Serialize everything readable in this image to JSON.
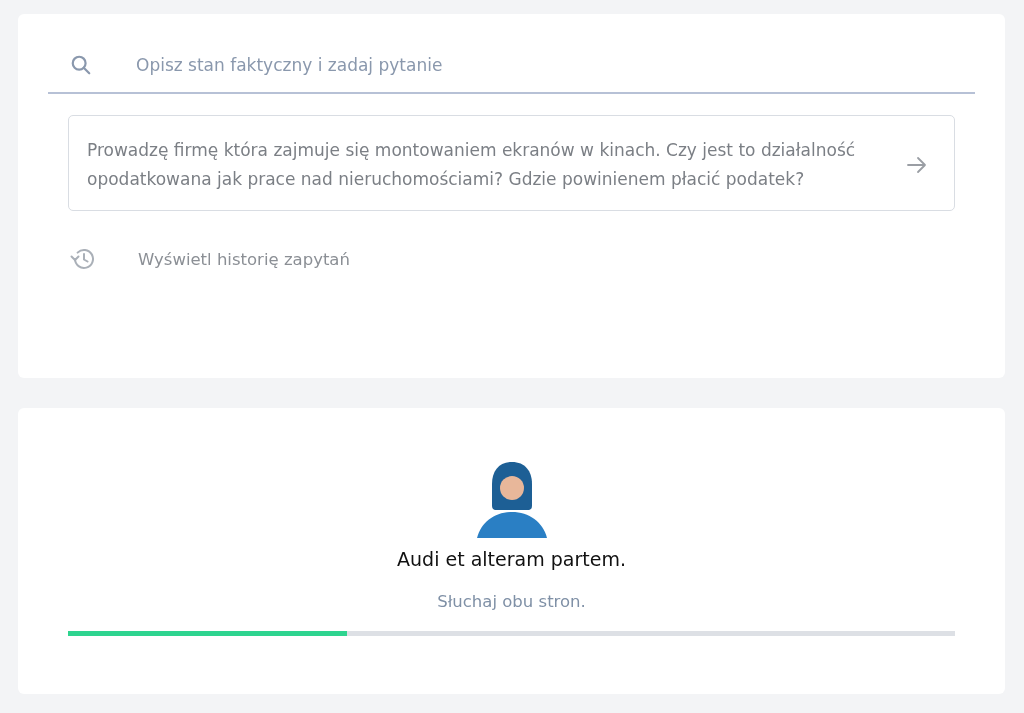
{
  "search": {
    "placeholder": "Opisz stan faktyczny i zadaj pytanie"
  },
  "question": {
    "value": "Prowadzę firmę która zajmuje się montowaniem ekranów w kinach. Czy jest to działalność opodatkowana jak prace nad nieruchomościami? Gdzie powinienem płacić podatek?"
  },
  "history_link": {
    "label": "Wyświetl historię zapytań"
  },
  "loading": {
    "quote": "Audi et alteram partem.",
    "translation": "Słuchaj obu stron.",
    "level": 0.315
  }
}
